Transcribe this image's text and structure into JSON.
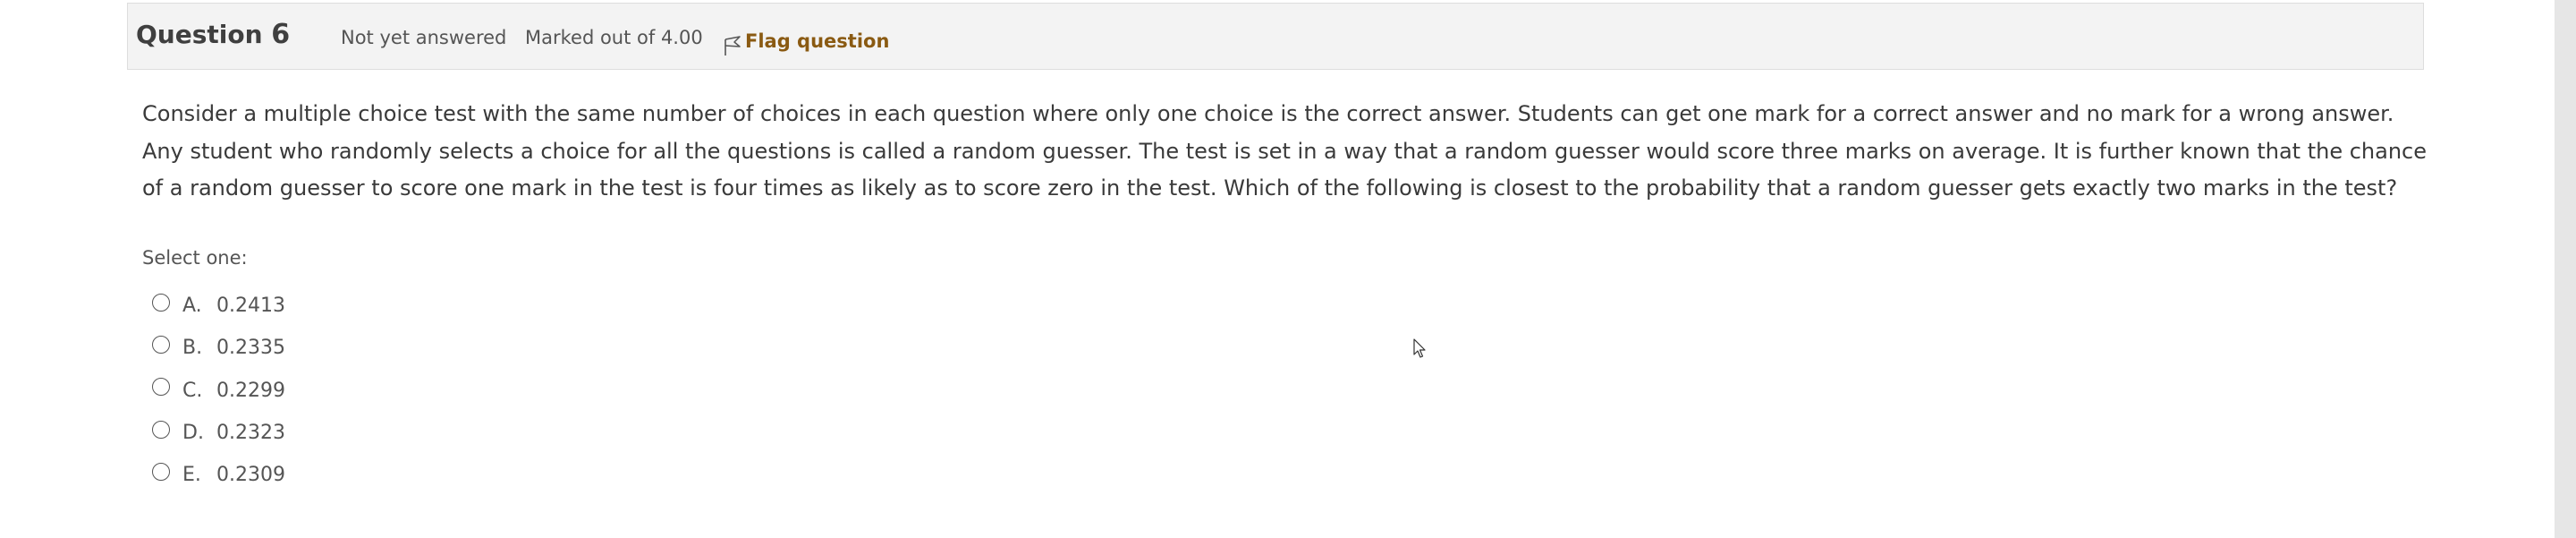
{
  "header": {
    "title_prefix": "Question",
    "number": "6",
    "state": "Not yet answered",
    "grade": "Marked out of 4.00",
    "flag_label": "Flag question",
    "flag_icon": "flag-icon"
  },
  "question_text": "Consider a multiple choice test with the same number of choices in each question where only one choice is the correct answer. Students can get one mark for a correct answer and no mark for a wrong answer. Any student who randomly selects a choice for all the questions is called a random guesser. The test is set in a way that a random guesser would score three marks on average. It is further known that the chance of a random guesser to score one mark in the test is four times as likely as to score zero in the test. Which of the following is closest to the probability that a random guesser gets exactly two marks in the test?",
  "prompt": "Select one:",
  "answers": [
    {
      "letter": "A.",
      "value": "0.2413"
    },
    {
      "letter": "B.",
      "value": "0.2335"
    },
    {
      "letter": "C.",
      "value": "0.2299"
    },
    {
      "letter": "D.",
      "value": "0.2323"
    },
    {
      "letter": "E.",
      "value": "0.2309"
    }
  ],
  "colors": {
    "header_bg": "#f3f3f3",
    "flag_text": "#8a5a12",
    "body_text": "#3a3a3a"
  }
}
